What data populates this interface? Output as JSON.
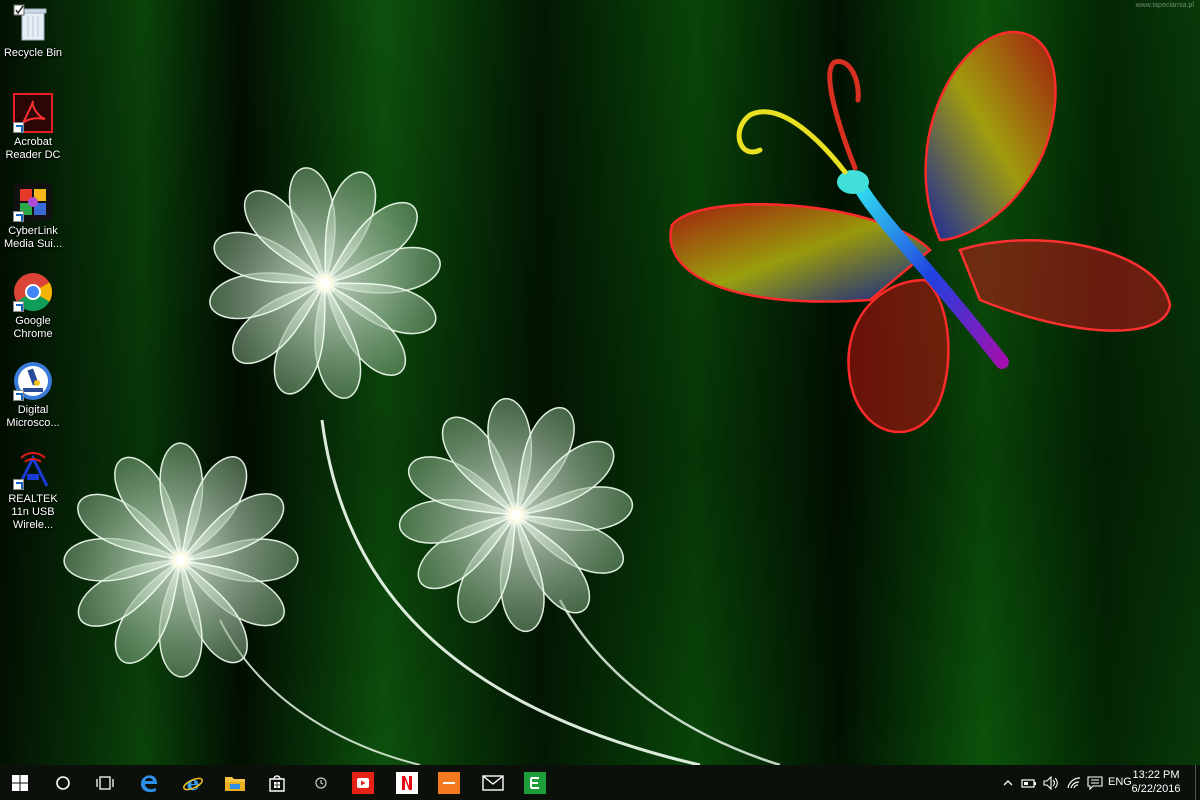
{
  "wallpaper": {
    "watermark": "www.tapeciarnia.pl",
    "accent": "#1fbf1f"
  },
  "desktop_icons": [
    {
      "label": "Recycle Bin",
      "icon": "recycle-bin-icon"
    },
    {
      "label": "Acrobat Reader DC",
      "icon": "acrobat-icon"
    },
    {
      "label": "CyberLink Media Sui...",
      "icon": "cyberlink-icon"
    },
    {
      "label": "Google Chrome",
      "icon": "chrome-icon"
    },
    {
      "label": "Digital Microsco...",
      "icon": "microscope-icon"
    },
    {
      "label": "REALTEK 11n USB Wirele...",
      "icon": "realtek-icon"
    }
  ],
  "taskbar": {
    "start": "windows-logo-icon",
    "pinned": [
      "cortana-icon",
      "task-view-icon",
      "edge-icon",
      "internet-explorer-icon",
      "file-explorer-icon",
      "store-icon",
      "clock-app-icon",
      "youtube-icon",
      "netflix-icon",
      "orange-app-icon",
      "mail-icon",
      "green-app-icon"
    ],
    "tray_icons": [
      "chevron-up-icon",
      "battery-icon",
      "volume-icon",
      "wifi-icon",
      "message-icon"
    ],
    "language": "ENG",
    "time": "13:22 PM",
    "date": "6/22/2016"
  }
}
